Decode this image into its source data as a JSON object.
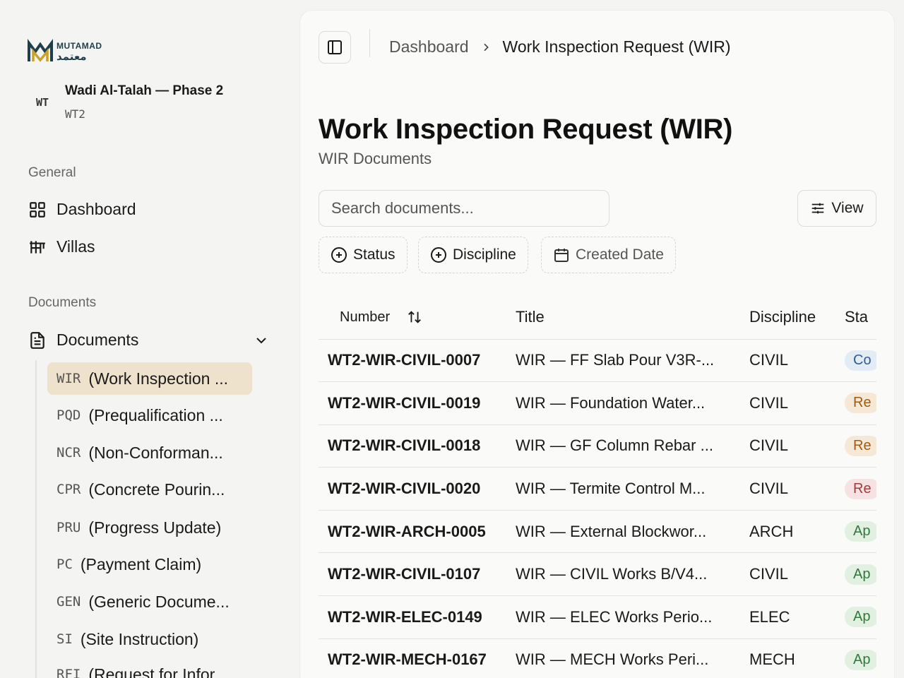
{
  "brand": {
    "name_en": "MUTAMAD",
    "name_ar": "معتمد",
    "color": "#1e3f4a",
    "accent": "#c9a227"
  },
  "project": {
    "avatar": "WT",
    "name": "Wadi Al-Talah — Phase 2",
    "code": "WT2"
  },
  "sidebar": {
    "general_label": "General",
    "general_items": [
      {
        "label": "Dashboard",
        "icon": "grid-icon"
      },
      {
        "label": "Villas",
        "icon": "villa-icon"
      }
    ],
    "documents_label": "Documents",
    "documents_group": {
      "label": "Documents",
      "icon": "document-icon"
    },
    "doc_types": [
      {
        "code": "WIR",
        "label": "(Work Inspection ...",
        "active": true
      },
      {
        "code": "PQD",
        "label": "(Prequalification ..."
      },
      {
        "code": "NCR",
        "label": "(Non-Conforman..."
      },
      {
        "code": "CPR",
        "label": "(Concrete Pourin..."
      },
      {
        "code": "PRU",
        "label": "(Progress Update)"
      },
      {
        "code": "PC",
        "label": "(Payment Claim)"
      },
      {
        "code": "GEN",
        "label": "(Generic Docume..."
      },
      {
        "code": "SI",
        "label": "(Site Instruction)"
      },
      {
        "code": "RFI",
        "label": "(Request for Infor..."
      }
    ]
  },
  "breadcrumb": {
    "parent": "Dashboard",
    "current": "Work Inspection Request (WIR)"
  },
  "page": {
    "title": "Work Inspection Request (WIR)",
    "subtitle": "WIR Documents"
  },
  "search": {
    "placeholder": "Search documents...",
    "value": ""
  },
  "toolbar": {
    "view_label": "View"
  },
  "filters": {
    "status": "Status",
    "discipline": "Discipline",
    "created_date": "Created Date"
  },
  "table": {
    "headers": {
      "number": "Number",
      "title": "Title",
      "discipline": "Discipline",
      "status": "Sta"
    },
    "rows": [
      {
        "number": "WT2-WIR-CIVIL-0007",
        "title": "WIR — FF Slab Pour V3R-...",
        "discipline": "CIVIL",
        "status": "Co",
        "status_bg": "#e3ecf5",
        "status_color": "#2d5f96"
      },
      {
        "number": "WT2-WIR-CIVIL-0019",
        "title": "WIR — Foundation Water...",
        "discipline": "CIVIL",
        "status": "Re",
        "status_bg": "#f5e8d6",
        "status_color": "#a25a12"
      },
      {
        "number": "WT2-WIR-CIVIL-0018",
        "title": "WIR — GF Column Rebar ...",
        "discipline": "CIVIL",
        "status": "Re",
        "status_bg": "#f5e8d6",
        "status_color": "#a25a12"
      },
      {
        "number": "WT2-WIR-CIVIL-0020",
        "title": "WIR — Termite Control M...",
        "discipline": "CIVIL",
        "status": "Re",
        "status_bg": "#f6e2e2",
        "status_color": "#a33b3b"
      },
      {
        "number": "WT2-WIR-ARCH-0005",
        "title": "WIR — External Blockwor...",
        "discipline": "ARCH",
        "status": "Ap",
        "status_bg": "#e2f0e2",
        "status_color": "#2f7a3a"
      },
      {
        "number": "WT2-WIR-CIVIL-0107",
        "title": "WIR — CIVIL Works B/V4...",
        "discipline": "CIVIL",
        "status": "Ap",
        "status_bg": "#e2f0e2",
        "status_color": "#2f7a3a"
      },
      {
        "number": "WT2-WIR-ELEC-0149",
        "title": "WIR — ELEC Works Perio...",
        "discipline": "ELEC",
        "status": "Ap",
        "status_bg": "#e2f0e2",
        "status_color": "#2f7a3a"
      },
      {
        "number": "WT2-WIR-MECH-0167",
        "title": "WIR — MECH Works Peri...",
        "discipline": "MECH",
        "status": "Ap",
        "status_bg": "#e2f0e2",
        "status_color": "#2f7a3a"
      }
    ]
  }
}
